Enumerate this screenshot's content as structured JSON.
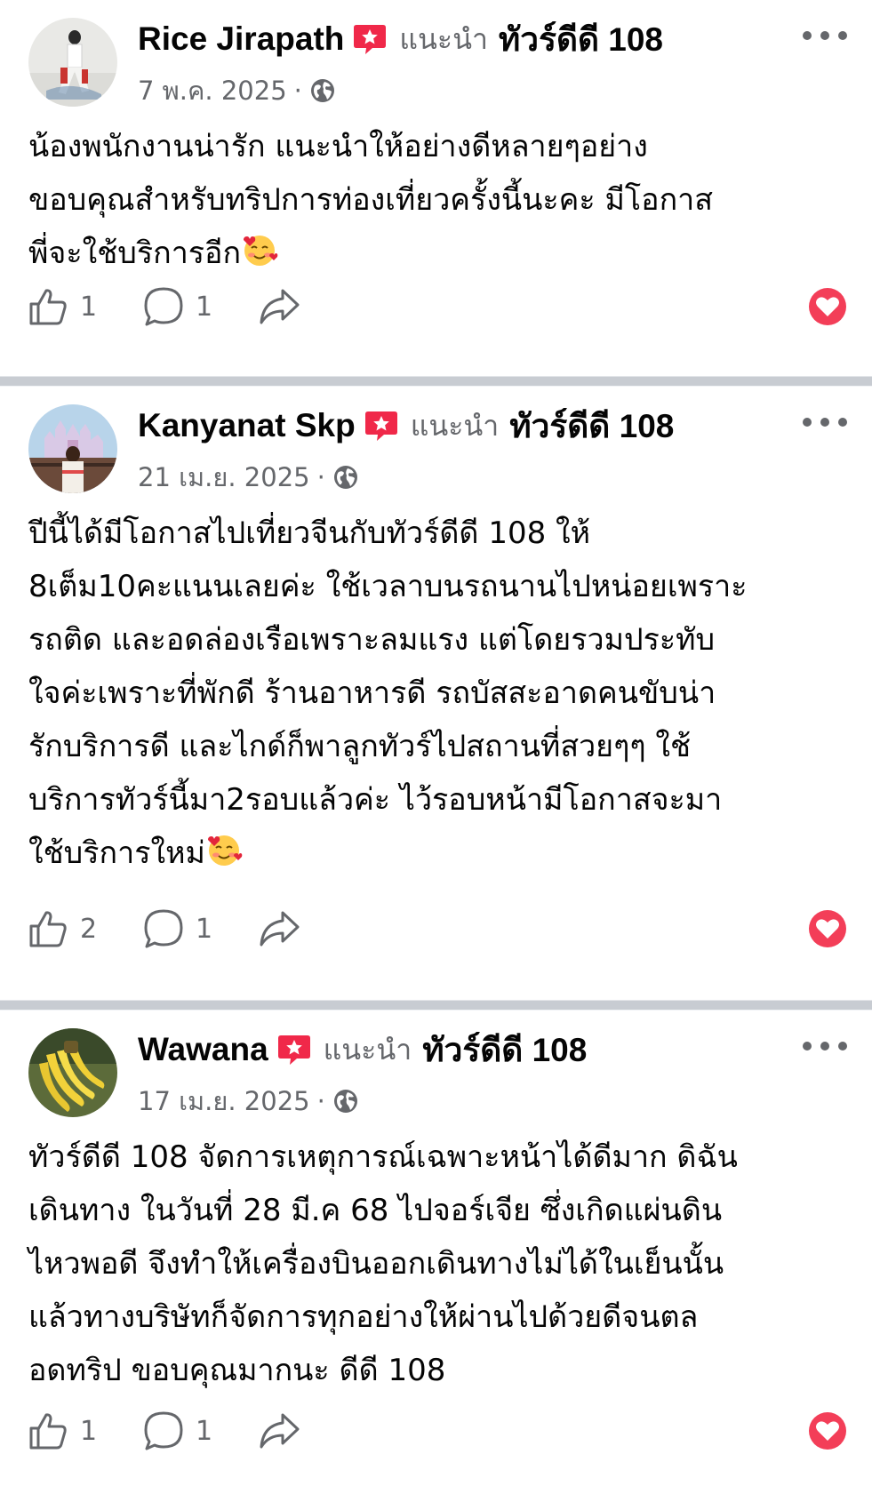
{
  "posts": [
    {
      "author": "Rice Jirapath",
      "recommend_text": "แนะนำ",
      "page_name": "ทัวร์ดีดี 108",
      "date": "7 พ.ค. 2025",
      "separator": "·",
      "lines": [
        "น้องพนักงานน่ารัก แนะนำให้อย่างดีหลายๆอย่าง",
        "ขอบคุณสำหรับทริปการท่องเที่ยวครั้งนี้นะคะ มีโอกาส",
        "พี่จะใช้บริการอีก"
      ],
      "likes": "1",
      "comments": "1"
    },
    {
      "author": "Kanyanat Skp",
      "recommend_text": "แนะนำ",
      "page_name": "ทัวร์ดีดี 108",
      "date": "21 เม.ย. 2025",
      "separator": "·",
      "lines": [
        "ปีนี้ได้มีโอกาสไปเที่ยวจีนกับทัวร์ดีดี 108 ให้",
        "8เต็ม10คะแนนเลยค่ะ ใช้เวลาบนรถนานไปหน่อยเพราะ",
        "รถติด และอดล่องเรือเพราะลมแรง แต่โดยรวมประทับ",
        "ใจค่ะเพราะที่พักดี ร้านอาหารดี รถบัสสะอาดคนขับน่า",
        "รักบริการดี และไกด์ก็พาลูกทัวร์ไปสถานที่สวยๆๆ ใช้",
        "บริการทัวร์นี้มา2รอบแล้วค่ะ ไว้รอบหน้ามีโอกาสจะมา",
        "ใช้บริการใหม่"
      ],
      "likes": "2",
      "comments": "1"
    },
    {
      "author": "Wawana",
      "recommend_text": "แนะนำ",
      "page_name": "ทัวร์ดีดี 108",
      "date": "17 เม.ย. 2025",
      "separator": "·",
      "lines": [
        "ทัวร์ดีดี 108 จัดการเหตุการณ์เฉพาะหน้าได้ดีมาก ดิฉัน",
        "เดินทาง ในวันที่ 28 มี.ค 68 ไปจอร์เจีย ซึ่งเกิดแผ่นดิน",
        "ไหวพอดี จึงทำให้เครื่องบินออกเดินทางไม่ได้ในเย็นนั้น",
        "แล้วทางบริษัทก็จัดการทุกอย่างให้ผ่านไปด้วยดีจนตล",
        "อดทริป ขอบคุณมากนะ ดีดี 108"
      ],
      "likes": "1",
      "comments": "1"
    }
  ],
  "colors": {
    "secondary_text": "#65676b",
    "recommend_badge": "#f02849",
    "love_reaction": "#f33e58",
    "separator": "#c8ccd2"
  },
  "icons": [
    "recommend-badge-icon",
    "globe-icon",
    "like-icon",
    "comment-icon",
    "share-icon",
    "love-reaction-icon",
    "smiling-hearts-emoji",
    "more-options-icon"
  ]
}
